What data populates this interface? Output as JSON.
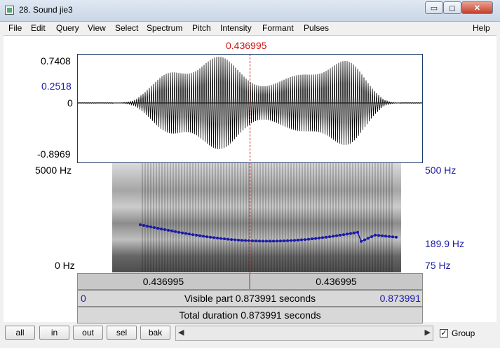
{
  "window": {
    "title": "28. Sound jie3",
    "min_glyph": "▭",
    "max_glyph": "◻",
    "close_glyph": "✕"
  },
  "menu": [
    {
      "key": "file",
      "label": "File"
    },
    {
      "key": "edit",
      "label": "Edit"
    },
    {
      "key": "query",
      "label": "Query"
    },
    {
      "key": "view",
      "label": "View"
    },
    {
      "key": "select",
      "label": "Select"
    },
    {
      "key": "spectrum",
      "label": "Spectrum"
    },
    {
      "key": "pitch",
      "label": "Pitch"
    },
    {
      "key": "intensity",
      "label": "Intensity"
    },
    {
      "key": "formant",
      "label": "Formant"
    },
    {
      "key": "pulses",
      "label": "Pulses"
    },
    {
      "key": "help",
      "label": "Help"
    }
  ],
  "cursor_time": "0.436995",
  "waveform": {
    "max": "0.7408",
    "cursor_value": "0.2518",
    "zero": "0",
    "min": "-0.8969"
  },
  "spectrogram": {
    "freq_top": "5000 Hz",
    "freq_bottom": "0 Hz"
  },
  "pitch": {
    "top": "500 Hz",
    "cursor_value": "189.9 Hz",
    "bottom": "75 Hz"
  },
  "selection": {
    "left": "0.436995",
    "right": "0.436995"
  },
  "visible": {
    "start": "0",
    "label": "Visible part 0.873991 seconds",
    "end": "0.873991"
  },
  "total": {
    "label": "Total duration 0.873991 seconds"
  },
  "buttons": {
    "all": "all",
    "in": "in",
    "out": "out",
    "sel": "sel",
    "bak": "bak"
  },
  "scroll": {
    "left_arrow": "◀",
    "right_arrow": "▶"
  },
  "group": {
    "label": "Group",
    "checked": true,
    "check_glyph": "✓"
  },
  "colors": {
    "waveform": "#000000",
    "pitch": "#1a1aa8",
    "cursor": "#cc1111",
    "axis_blue": "#1a1aa8"
  }
}
